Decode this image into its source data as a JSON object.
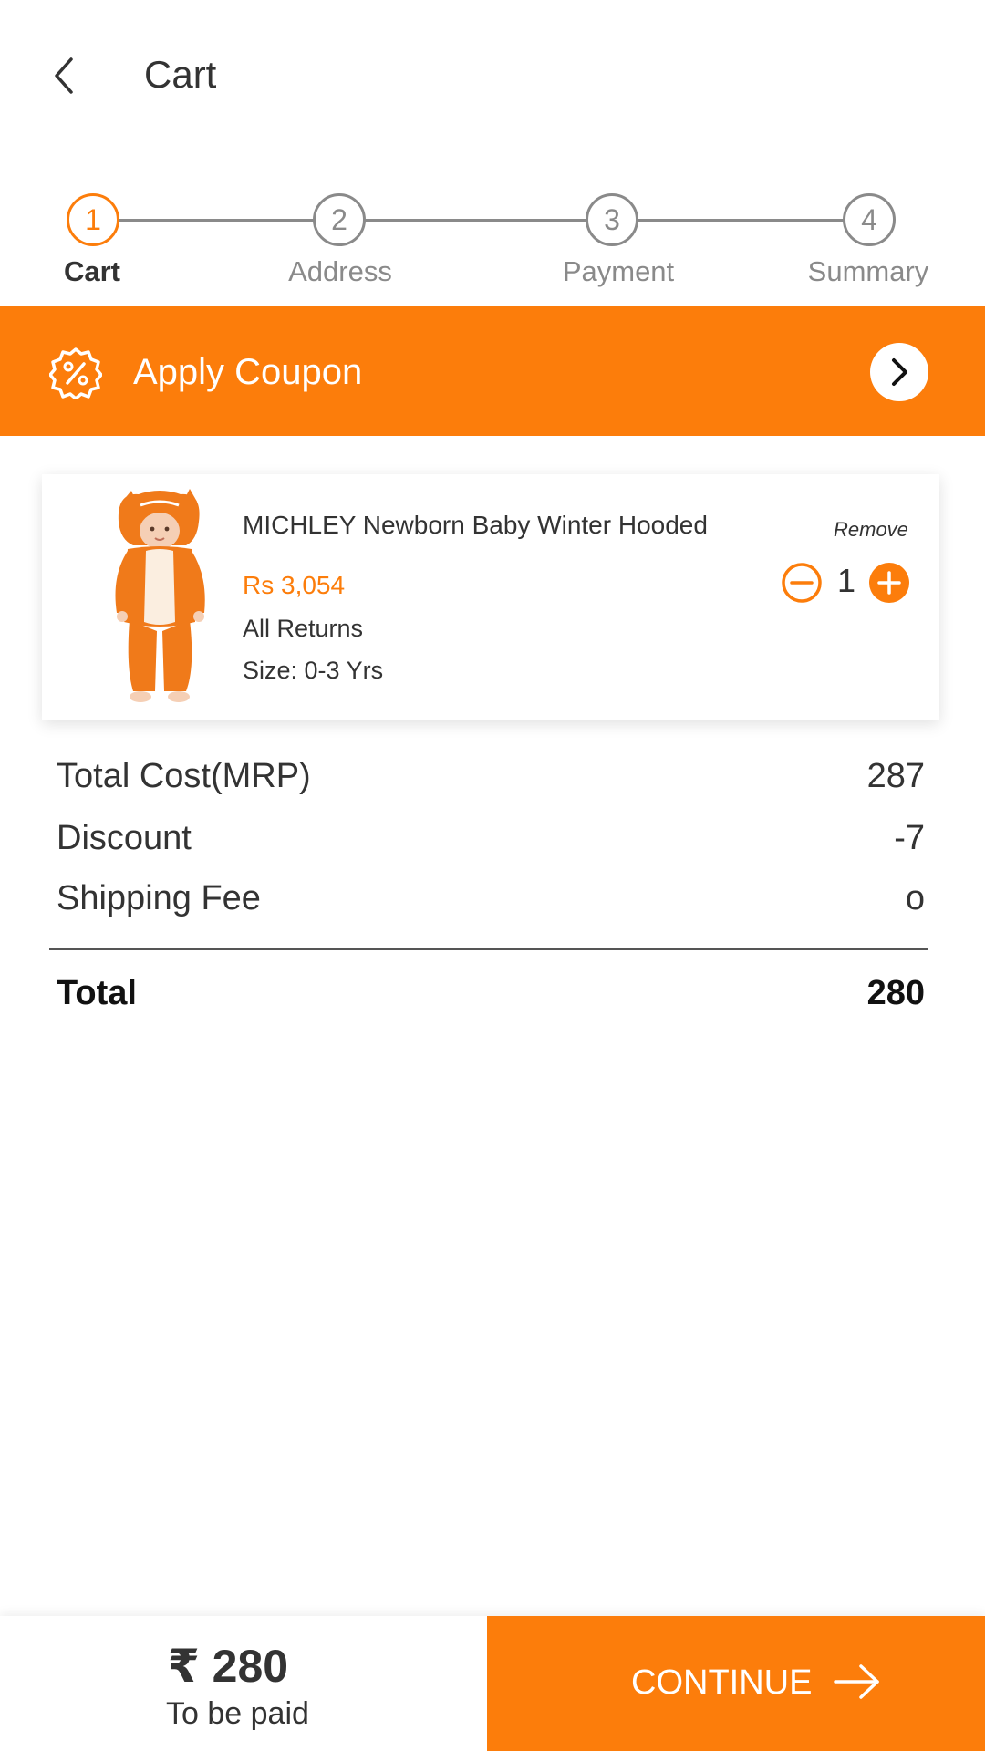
{
  "header": {
    "title": "Cart",
    "back_icon": "chevron-left-icon"
  },
  "stepper": {
    "steps": [
      {
        "number": "1",
        "label": "Cart",
        "active": true
      },
      {
        "number": "2",
        "label": "Address",
        "active": false
      },
      {
        "number": "3",
        "label": "Payment",
        "active": false
      },
      {
        "number": "4",
        "label": "Summary",
        "active": false
      }
    ]
  },
  "coupon": {
    "label": "Apply Coupon",
    "icon": "discount-badge-icon",
    "arrow_icon": "chevron-right-icon"
  },
  "cart_item": {
    "name": "MICHLEY Newborn Baby Winter Hooded",
    "price": "Rs 3,054",
    "returns": "All Returns",
    "size": "Size: 0-3 Yrs",
    "remove_label": "Remove",
    "quantity": "1"
  },
  "summary": {
    "rows": [
      {
        "label": "Total Cost(MRP)",
        "value": "287"
      },
      {
        "label": "Discount",
        "value": "-7"
      },
      {
        "label": "Shipping Fee",
        "value": "o"
      }
    ],
    "total_label": "Total",
    "total_value": "280"
  },
  "footer": {
    "amount": "₹ 280",
    "caption": "To be paid",
    "continue_label": "CONTINUE"
  },
  "colors": {
    "accent": "#fc7d0b",
    "text": "#333333",
    "muted": "#8a8a8a"
  }
}
